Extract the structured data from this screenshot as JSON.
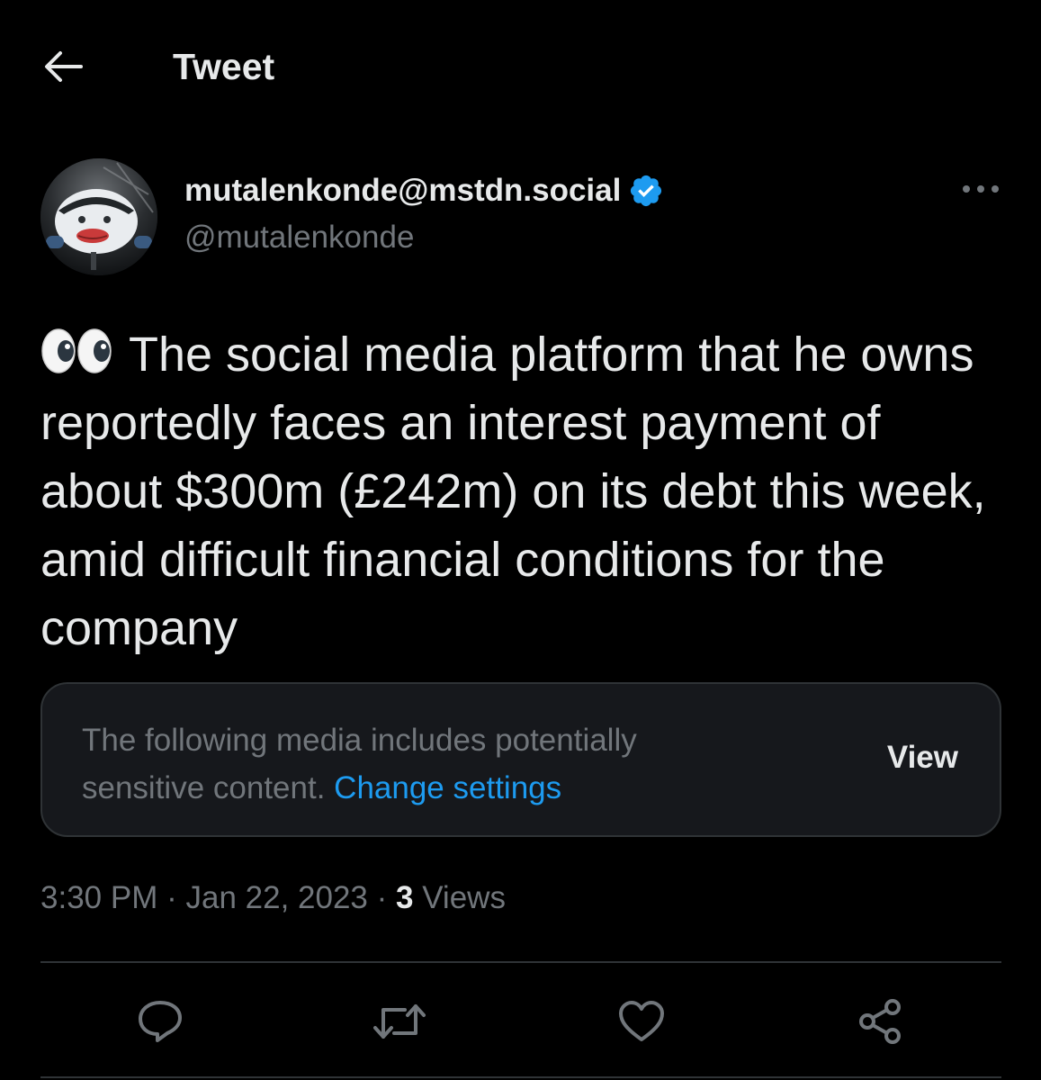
{
  "header": {
    "title": "Tweet",
    "back_icon": "arrow-left-icon"
  },
  "author": {
    "display_name": "mutalenkonde@mstdn.social",
    "handle": "@mutalenkonde",
    "verified": true,
    "verified_color": "#1d9bf0"
  },
  "tweet": {
    "emoji": "👀",
    "text": "The social media platform that he owns reportedly faces an interest payment of about $300m (£242m) on its debt this week, amid difficult financial conditions for the company"
  },
  "sensitive_notice": {
    "message": "The following media includes potentially sensitive content.",
    "link_label": "Change settings",
    "view_label": "View"
  },
  "meta": {
    "time": "3:30 PM",
    "separator": "·",
    "date": "Jan 22, 2023",
    "views_count": "3",
    "views_label": "Views"
  },
  "actions": [
    {
      "name": "reply",
      "icon": "reply-icon"
    },
    {
      "name": "retweet",
      "icon": "retweet-icon"
    },
    {
      "name": "like",
      "icon": "heart-icon"
    },
    {
      "name": "share",
      "icon": "share-icon"
    }
  ],
  "colors": {
    "background": "#000000",
    "text_primary": "#e7e9ea",
    "text_secondary": "#71767b",
    "accent": "#1d9bf0",
    "divider": "#2f3336",
    "card_background": "#16181c"
  }
}
